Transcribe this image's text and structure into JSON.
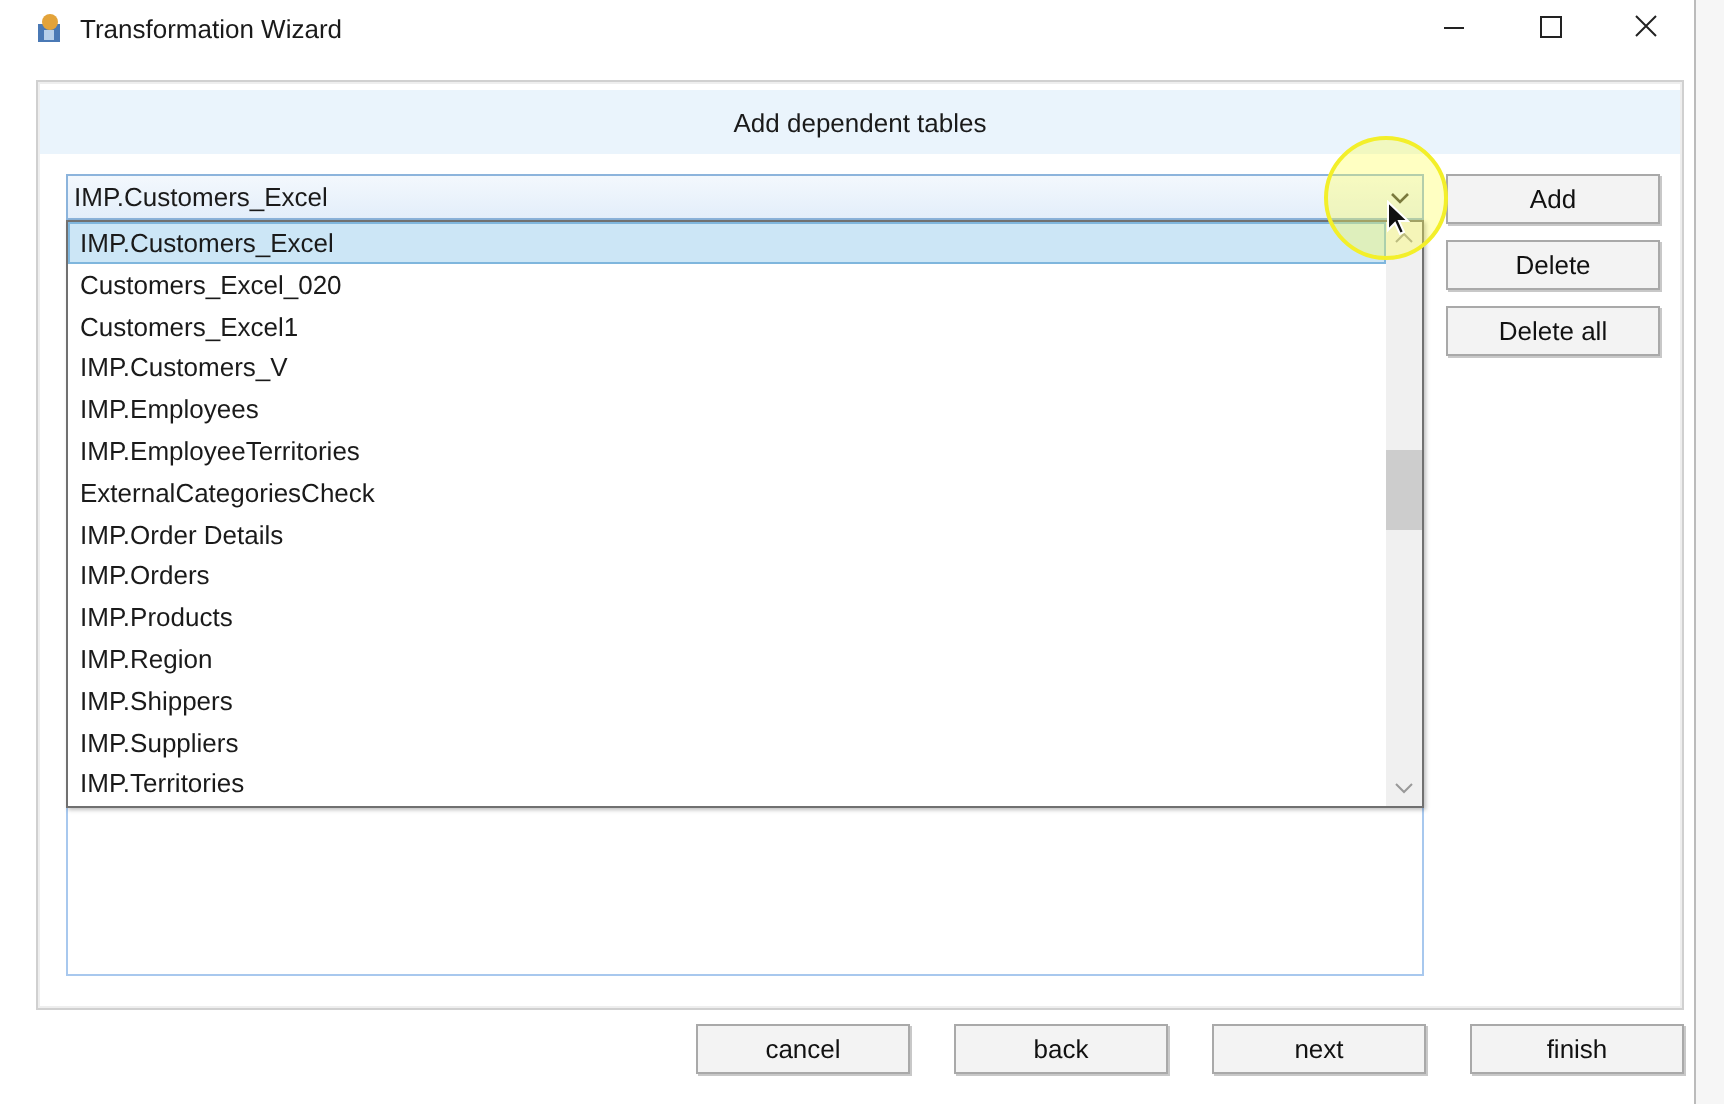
{
  "window": {
    "title": "Transformation Wizard"
  },
  "header": "Add dependent tables",
  "combo": {
    "value": "IMP.Customers_Excel",
    "expanded": true
  },
  "dropdown_items": [
    {
      "label": "IMP.Customers_Excel",
      "selected": true
    },
    {
      "label": "Customers_Excel_020",
      "selected": false
    },
    {
      "label": "Customers_Excel1",
      "selected": false
    },
    {
      "label": "IMP.Customers_V",
      "selected": false
    },
    {
      "label": "IMP.Employees",
      "selected": false
    },
    {
      "label": "IMP.EmployeeTerritories",
      "selected": false
    },
    {
      "label": "ExternalCategoriesCheck",
      "selected": false
    },
    {
      "label": "IMP.Order Details",
      "selected": false
    },
    {
      "label": "IMP.Orders",
      "selected": false
    },
    {
      "label": "IMP.Products",
      "selected": false
    },
    {
      "label": "IMP.Region",
      "selected": false
    },
    {
      "label": "IMP.Shippers",
      "selected": false
    },
    {
      "label": "IMP.Suppliers",
      "selected": false
    },
    {
      "label": "IMP.Territories",
      "selected": false
    }
  ],
  "side_buttons": [
    "Add",
    "Delete",
    "Delete all"
  ],
  "footer_buttons": [
    "cancel",
    "back",
    "next",
    "finish"
  ]
}
